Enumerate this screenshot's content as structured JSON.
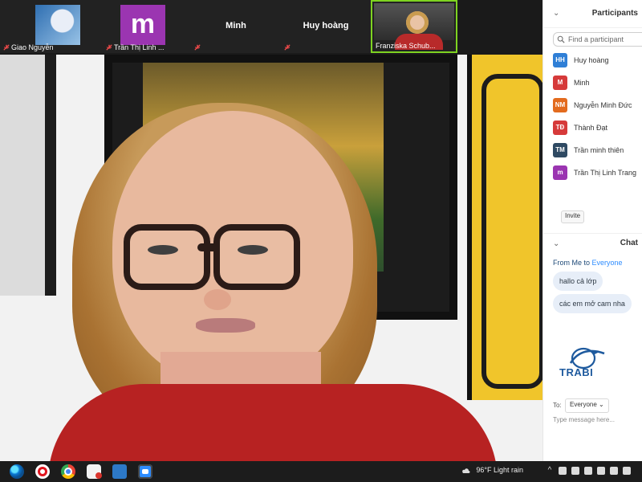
{
  "top_strip": {
    "tiles": [
      {
        "name": "Giao Nguyễn"
      },
      {
        "name": "Trần Thị Linh ..."
      },
      {
        "name": "Minh"
      },
      {
        "name": "Huy hoàng"
      },
      {
        "name": "Franziska Schub..."
      }
    ],
    "tile_m_letter": "m"
  },
  "panel": {
    "participants_title": "Participants",
    "search_placeholder": "Find a participant",
    "participants": [
      {
        "initials": "HH",
        "name": "Huy hoàng",
        "color": "#2f7fd6"
      },
      {
        "initials": "M",
        "name": "Minh",
        "color": "#d63a3a"
      },
      {
        "initials": "NM",
        "name": "Nguyễn Minh Đức",
        "color": "#e36b1e"
      },
      {
        "initials": "TĐ",
        "name": "Thành Đạt",
        "color": "#d63a3a"
      },
      {
        "initials": "TM",
        "name": "Trần minh thiên",
        "color": "#2f4a63"
      },
      {
        "initials": "m",
        "name": "Trần Thị Linh Trang",
        "color": "#9b35b1"
      }
    ],
    "invite_label": "Invite",
    "chat_title": "Chat",
    "chat_from": "From Me to",
    "chat_everyone": "Everyone",
    "messages": [
      "hallo cả lớp",
      "các em mở cam nha"
    ],
    "logo_text": "TRABI",
    "to_label": "To:",
    "to_value": "Everyone",
    "message_placeholder": "Type message here..."
  },
  "taskbar": {
    "weather": "96°F  Light rain"
  },
  "colors": {
    "active_tile_border": "#7ed321",
    "accent_blue": "#2d8cff"
  }
}
